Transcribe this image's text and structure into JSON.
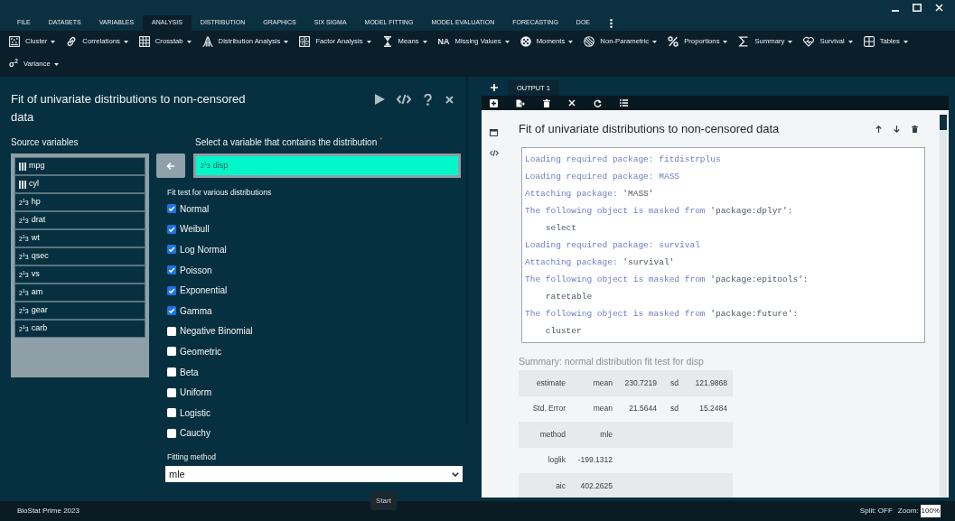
{
  "menu_tabs": [
    {
      "label": "FILE",
      "selected": false
    },
    {
      "label": "DATASETS",
      "selected": false
    },
    {
      "label": "VARIABLES",
      "selected": false
    },
    {
      "label": "ANALYSIS",
      "selected": true
    },
    {
      "label": "DISTRIBUTION",
      "selected": false
    },
    {
      "label": "GRAPHICS",
      "selected": false
    },
    {
      "label": "SIX SIGMA",
      "selected": false
    },
    {
      "label": "MODEL FITTING",
      "selected": false
    },
    {
      "label": "MODEL EVALUATION",
      "selected": false
    },
    {
      "label": "FORECASTING",
      "selected": false
    },
    {
      "label": "DOE",
      "selected": false
    }
  ],
  "toolbar": [
    {
      "label": "Cluster"
    },
    {
      "label": "Correlations"
    },
    {
      "label": "Crosstab"
    },
    {
      "label": "Distribution Analysis"
    },
    {
      "label": "Factor Analysis"
    },
    {
      "label": "Means"
    },
    {
      "label": "Missing Values",
      "icon_text": "NA"
    },
    {
      "label": "Moments"
    },
    {
      "label": "Non-Parametric"
    },
    {
      "label": "Proportions"
    },
    {
      "label": "Summary"
    },
    {
      "label": "Survival"
    },
    {
      "label": "Tables"
    },
    {
      "label": "Variance",
      "icon_text": "σ$^{2}$"
    }
  ],
  "dialog": {
    "title": "Fit of univariate distributions to non-censored data",
    "source_label": "Source variables",
    "variables": [
      {
        "name": "mpg",
        "kind": "factor"
      },
      {
        "name": "cyl",
        "kind": "factor"
      },
      {
        "name": "hp",
        "kind": "numeric",
        "icon_text": "2$^{1}$3"
      },
      {
        "name": "drat",
        "kind": "numeric",
        "icon_text": "2$^{1}$3"
      },
      {
        "name": "wt",
        "kind": "numeric",
        "icon_text": "2$^{1}$3"
      },
      {
        "name": "qsec",
        "kind": "numeric",
        "icon_text": "2$^{1}$3"
      },
      {
        "name": "vs",
        "kind": "numeric",
        "icon_text": "2$^{1}$3"
      },
      {
        "name": "am",
        "kind": "numeric",
        "icon_text": "2$^{1}$3"
      },
      {
        "name": "gear",
        "kind": "numeric",
        "icon_text": "2$^{1}$3"
      },
      {
        "name": "carb",
        "kind": "numeric",
        "icon_text": "2$^{1}$3"
      }
    ],
    "target_label": "Select a variable that contains the distribution",
    "required_mark": "*",
    "target": {
      "name": "disp",
      "icon_text": "2$^{1}$3"
    },
    "tests_label": "Fit test for various distributions",
    "tests": [
      {
        "label": "Normal",
        "checked": true
      },
      {
        "label": "Weibull",
        "checked": true
      },
      {
        "label": "Log Normal",
        "checked": true
      },
      {
        "label": "Poisson",
        "checked": true
      },
      {
        "label": "Exponential",
        "checked": true
      },
      {
        "label": "Gamma",
        "checked": true
      },
      {
        "label": "Negative Binomial",
        "checked": false
      },
      {
        "label": "Geometric",
        "checked": false
      },
      {
        "label": "Beta",
        "checked": false
      },
      {
        "label": "Uniform",
        "checked": false
      },
      {
        "label": "Logistic",
        "checked": false
      },
      {
        "label": "Cauchy",
        "checked": false
      }
    ],
    "method_label": "Fitting method",
    "method": "mle",
    "start_button": "Start"
  },
  "output": {
    "tabs": [
      {
        "label": "OUTPUT 1",
        "selected": true
      }
    ],
    "title": "Fit of univariate distributions to non-censored data",
    "console": [
      {
        "parts": [
          {
            "text": "Loading required package: fitdistrplus",
            "kind": "message"
          }
        ]
      },
      {
        "parts": [
          {
            "text": "Loading required package: MASS",
            "kind": "message"
          }
        ]
      },
      {
        "parts": [
          {
            "text": "Attaching package:",
            "kind": "message"
          },
          {
            "text": "'MASS'",
            "kind": "quoted"
          }
        ]
      },
      {
        "parts": [
          {
            "text": "The following object is masked from",
            "kind": "message"
          },
          {
            "text": "'package:dplyr':",
            "kind": "quoted"
          }
        ]
      },
      {
        "parts": [
          {
            "text": "select",
            "kind": "output"
          }
        ]
      },
      {
        "parts": [
          {
            "text": "Loading required package: survival",
            "kind": "message"
          }
        ]
      },
      {
        "parts": [
          {
            "text": "Attaching package:",
            "kind": "message"
          },
          {
            "text": "'survival'",
            "kind": "quoted"
          }
        ]
      },
      {
        "parts": [
          {
            "text": "The following object is masked from",
            "kind": "message"
          },
          {
            "text": "'package:epitools':",
            "kind": "quoted"
          }
        ]
      },
      {
        "parts": [
          {
            "text": "ratetable",
            "kind": "output"
          }
        ]
      },
      {
        "parts": [
          {
            "text": "The following object is masked from",
            "kind": "message"
          },
          {
            "text": "'package:future':",
            "kind": "quoted"
          }
        ]
      },
      {
        "parts": [
          {
            "text": "cluster",
            "kind": "output"
          }
        ]
      }
    ],
    "summary_title": "Summary: normal distribution fit test for disp",
    "summary_rows": [
      [
        "estimate",
        "mean",
        "230.7219",
        "sd",
        "121.9868"
      ],
      [
        "Std. Error",
        "mean",
        "21.5644",
        "sd",
        "15.2484"
      ],
      [
        "method",
        "mle"
      ],
      [
        "loglik",
        "-199.1312"
      ],
      [
        "aic",
        "402.2625"
      ]
    ]
  },
  "status_bar": {
    "app": "BioStat Prime 2023",
    "split": "Split: OFF",
    "zoom_label": "Zoom:",
    "zoom": "100%"
  }
}
